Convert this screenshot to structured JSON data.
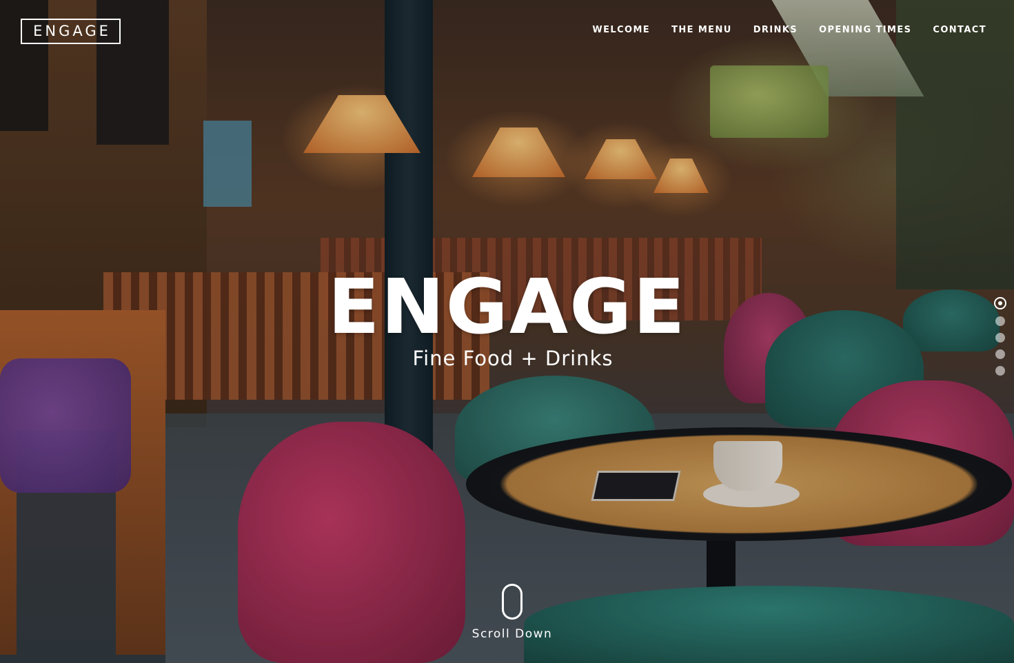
{
  "header": {
    "logo_text": "ENGAGE",
    "nav": [
      {
        "label": "WELCOME"
      },
      {
        "label": "THE MENU"
      },
      {
        "label": "DRINKS"
      },
      {
        "label": "OPENING TIMES"
      },
      {
        "label": "CONTACT"
      }
    ]
  },
  "hero": {
    "title": "ENGAGE",
    "subtitle": "Fine Food + Drinks",
    "background_image": "outdoor-cafe-terrace-photo",
    "scroll_label": "Scroll Down",
    "scroll_icon": "mouse-icon"
  },
  "pagination": {
    "total": 5,
    "active_index": 0
  },
  "colors": {
    "text": "#ffffff",
    "inactive_dot": "rgba(255,255,255,0.55)"
  }
}
